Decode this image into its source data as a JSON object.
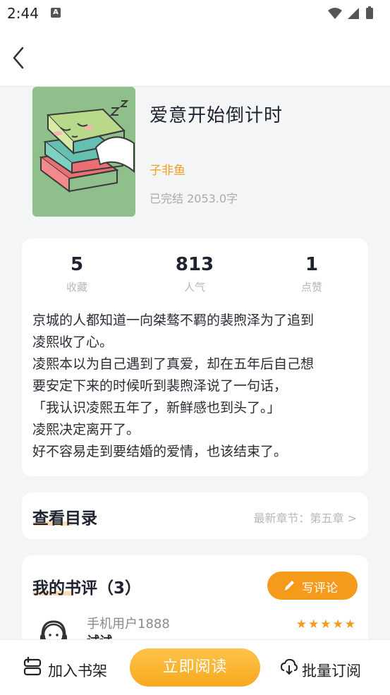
{
  "status": {
    "time": "2:44"
  },
  "book": {
    "title": "爱意开始倒计时",
    "author": "子非鱼",
    "meta": "已完结 2053.0字"
  },
  "stats": [
    {
      "value": "5",
      "label": "收藏"
    },
    {
      "value": "813",
      "label": "人气"
    },
    {
      "value": "1",
      "label": "点赞"
    }
  ],
  "synopsis": [
    "京城的人都知道一向桀骜不羁的裴煦泽为了追到",
    "凌熙收了心。",
    "凌熙本以为自己遇到了真爱，却在五年后自己想",
    "要安定下来的时候听到裴煦泽说了一句话，",
    "「我认识凌熙五年了，新鲜感也到头了。」",
    "凌熙决定离开了。",
    "好不容易走到要结婚的爱情，也该结束了。"
  ],
  "catalog": {
    "title": "查看目录",
    "latest": "最新章节：第五章 >"
  },
  "reviews": {
    "title": "我的书评（3）",
    "write_label": "写评论",
    "first": {
      "user": "手机用户1888",
      "text": "试试",
      "stars": "★★★★★"
    }
  },
  "bottom": {
    "shelf_label": "加入书架",
    "read_label": "立即阅读",
    "subscribe_label": "批量订阅"
  },
  "colors": {
    "accent": "#f59a1a",
    "author": "#f0a020"
  }
}
